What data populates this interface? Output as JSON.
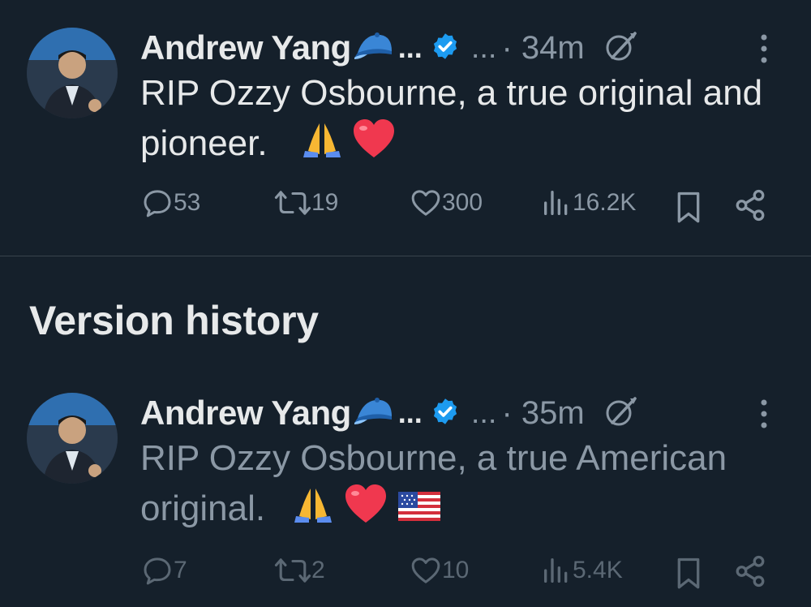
{
  "tweets": [
    {
      "author": "Andrew Yang",
      "ellipsis": "...",
      "meta_dots": "...",
      "time": "· 34m",
      "text": "RIP Ozzy Osbourne, a true original and pioneer.",
      "emojis": [
        "folded-hands",
        "red-heart"
      ],
      "counts": {
        "replies": "53",
        "reposts": "19",
        "likes": "300",
        "views": "16.2K"
      }
    },
    {
      "author": "Andrew Yang",
      "ellipsis": "...",
      "meta_dots": "...",
      "time": "· 35m",
      "text": "RIP Ozzy Osbourne, a true American original.",
      "emojis": [
        "folded-hands",
        "red-heart",
        "us-flag"
      ],
      "counts": {
        "replies": "7",
        "reposts": "2",
        "likes": "10",
        "views": "5.4K"
      }
    }
  ],
  "section_title": "Version history",
  "colors": {
    "background": "#15202b",
    "text": "#e7e9ea",
    "muted": "#8b98a5",
    "verified": "#1d9bf0",
    "divider": "#38444d"
  }
}
